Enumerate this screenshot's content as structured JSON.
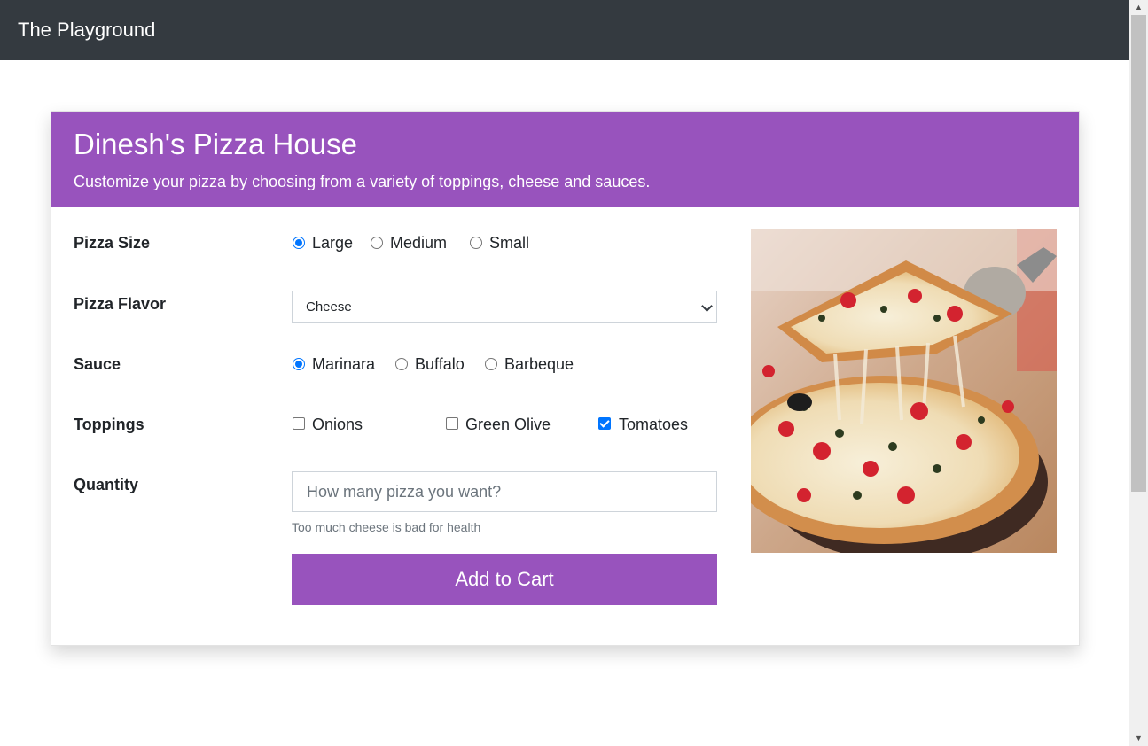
{
  "navbar": {
    "brand": "The Playground"
  },
  "card": {
    "title": "Dinesh's Pizza House",
    "subtitle": "Customize your pizza by choosing from a variety of toppings, cheese and sauces."
  },
  "form": {
    "size": {
      "label": "Pizza Size",
      "options": [
        "Large",
        "Medium",
        "Small"
      ],
      "selected": "Large"
    },
    "flavor": {
      "label": "Pizza Flavor",
      "value": "Cheese"
    },
    "sauce": {
      "label": "Sauce",
      "options": [
        "Marinara",
        "Buffalo",
        "Barbeque"
      ],
      "selected": "Marinara"
    },
    "toppings": {
      "label": "Toppings",
      "options": [
        "Onions",
        "Green Olive",
        "Tomatoes"
      ],
      "checked": [
        "Tomatoes"
      ]
    },
    "quantity": {
      "label": "Quantity",
      "placeholder": "How many pizza you want?",
      "value": "",
      "hint": "Too much cheese is bad for health"
    },
    "submit_label": "Add to Cart"
  },
  "colors": {
    "accent": "#9853bd",
    "navbar": "#343a40",
    "control": "#0075ff"
  },
  "icons": {
    "select": "chevron-down-icon",
    "image": "pizza-photo"
  }
}
